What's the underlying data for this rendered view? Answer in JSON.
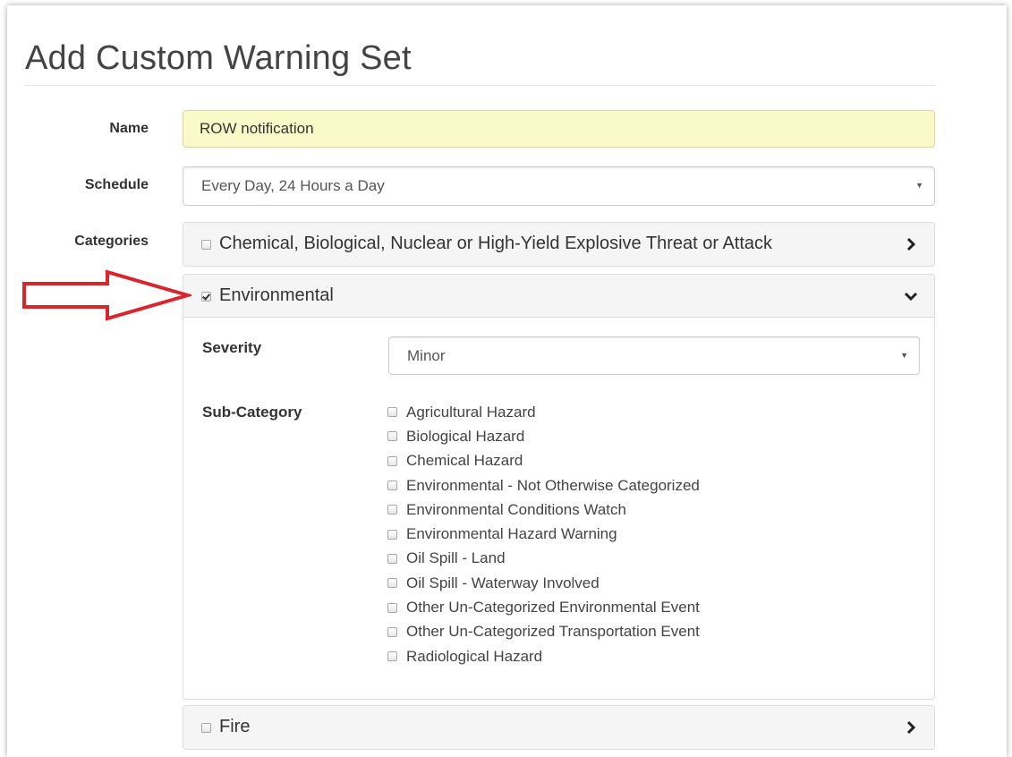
{
  "page": {
    "title": "Add Custom Warning Set"
  },
  "form": {
    "name_label": "Name",
    "name_value": "ROW notification",
    "schedule_label": "Schedule",
    "schedule_value": "Every Day, 24 Hours a Day",
    "categories_label": "Categories"
  },
  "categories": [
    {
      "label": "Chemical, Biological, Nuclear or High-Yield Explosive Threat or Attack",
      "checked": false,
      "expanded": false,
      "icon": "chevron-right-icon"
    },
    {
      "label": "Environmental",
      "checked": true,
      "expanded": true,
      "icon": "chevron-down-icon",
      "severity_label": "Severity",
      "severity_value": "Minor",
      "subcategory_label": "Sub-Category",
      "subcategories": [
        "Agricultural Hazard",
        "Biological Hazard",
        "Chemical Hazard",
        "Environmental - Not Otherwise Categorized",
        "Environmental Conditions Watch",
        "Environmental Hazard Warning",
        "Oil Spill - Land",
        "Oil Spill - Waterway Involved",
        "Other Un-Categorized Environmental Event",
        "Other Un-Categorized Transportation Event",
        "Radiological Hazard"
      ]
    },
    {
      "label": "Fire",
      "checked": false,
      "expanded": false,
      "icon": "chevron-right-icon"
    }
  ],
  "colors": {
    "name_input_bg": "#fafac8",
    "annotation_arrow": "#d9262c",
    "panel_heading_bg": "#f5f5f5"
  },
  "annotation": {
    "icon": "red-outline-arrow-icon"
  }
}
